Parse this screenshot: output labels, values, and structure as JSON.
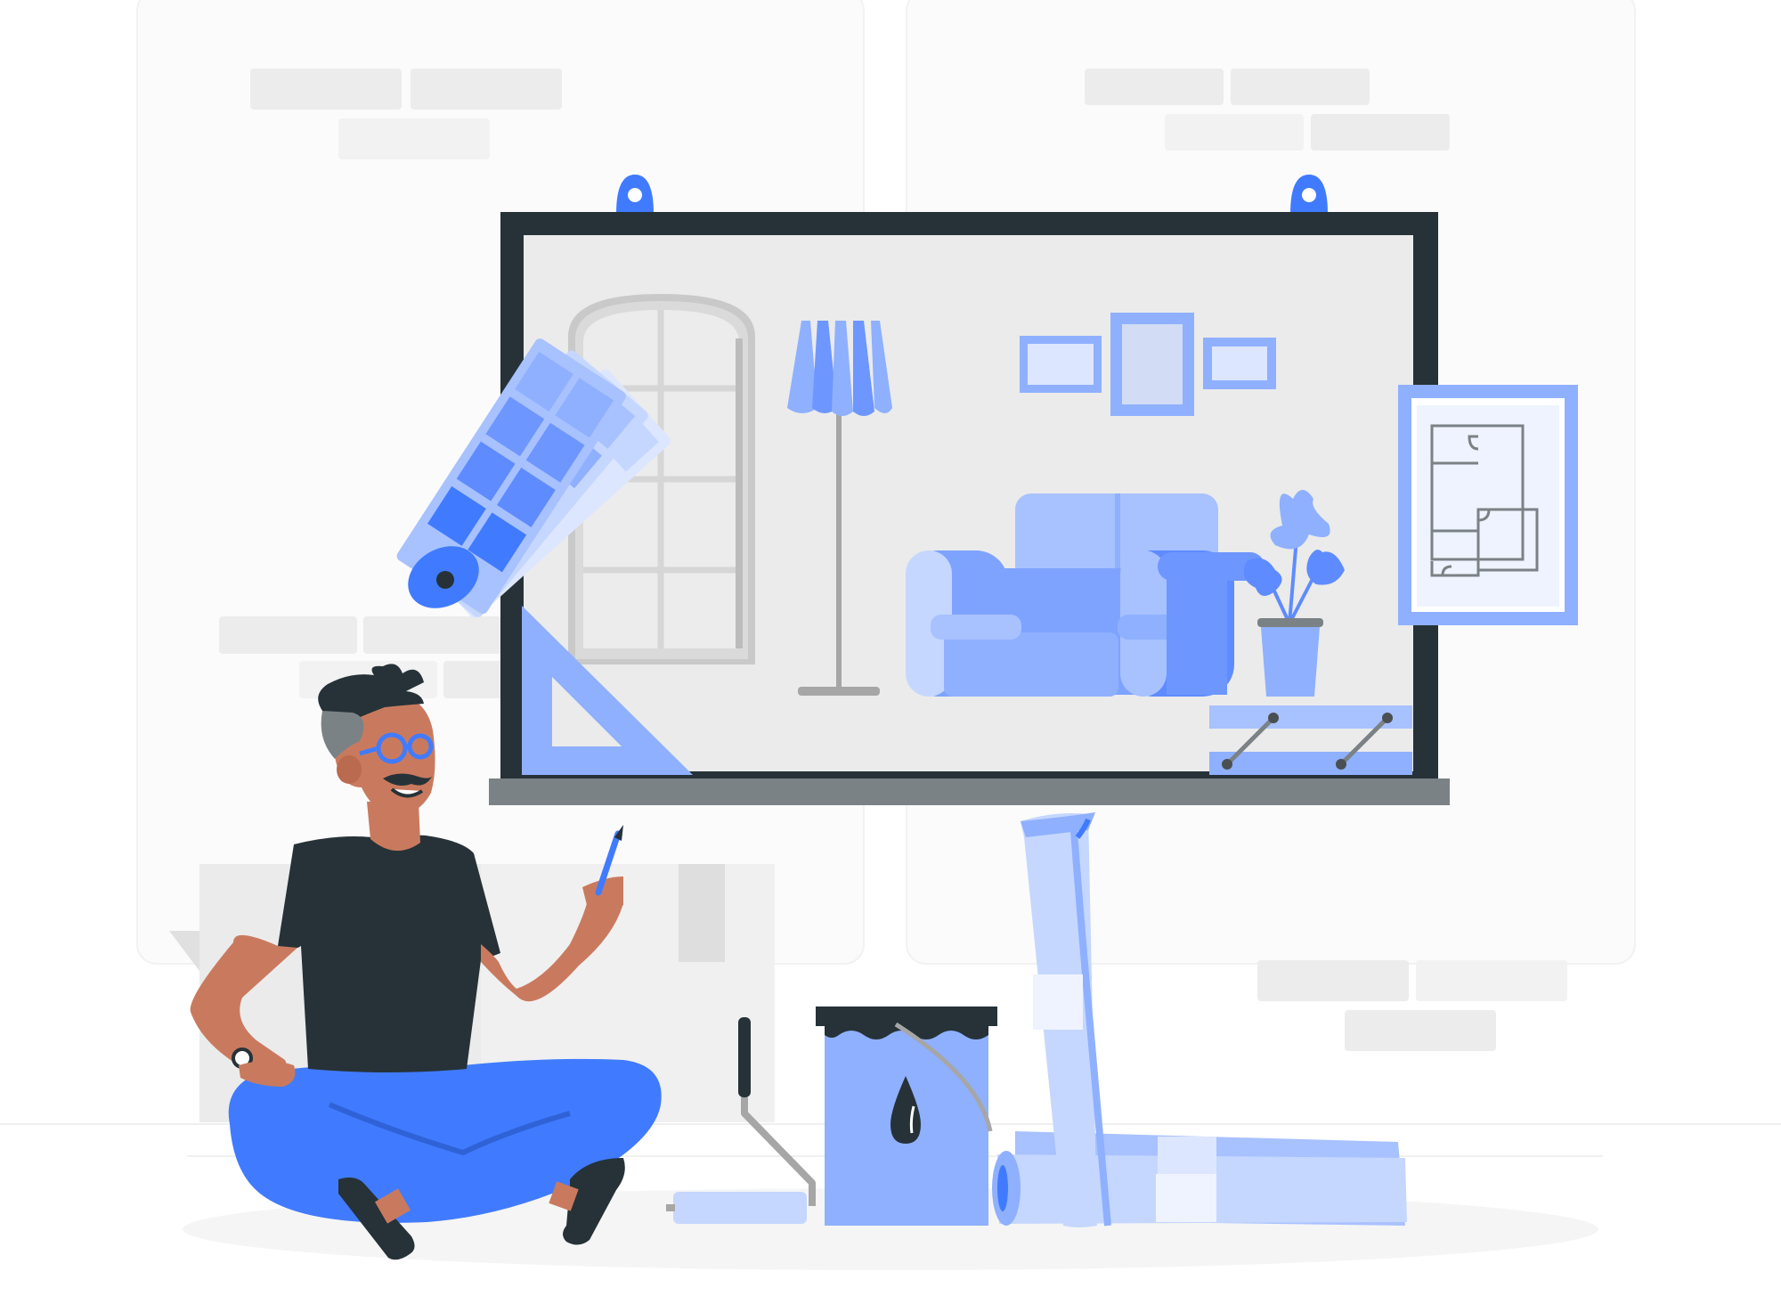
{
  "scene": {
    "description_free": true,
    "colors": {
      "background": "#ffffff",
      "wall_panel": "#fbfbfb",
      "brick": "#ebebeb",
      "board_frame": "#263238",
      "board_surface": "#ebebeb",
      "accent": "#407bff",
      "accent_light": "#8fb0ff",
      "accent_pale": "#c5d7ff",
      "skin": "#c97a5e",
      "shirt": "#263238",
      "ground": "#f5f5f5",
      "ledge": "#7b8285",
      "window_frame": "#c7c7c7"
    },
    "icons": {
      "swatch_fan": "color-swatch-fan-icon",
      "floor_plan": "floor-plan-icon",
      "triangle_ruler": "set-square-icon",
      "paint_bucket": "paint-bucket-icon",
      "paint_roller": "paint-roller-icon",
      "rolled_blueprints": "blueprint-rolls-icon",
      "pencil": "pencil-icon"
    }
  }
}
